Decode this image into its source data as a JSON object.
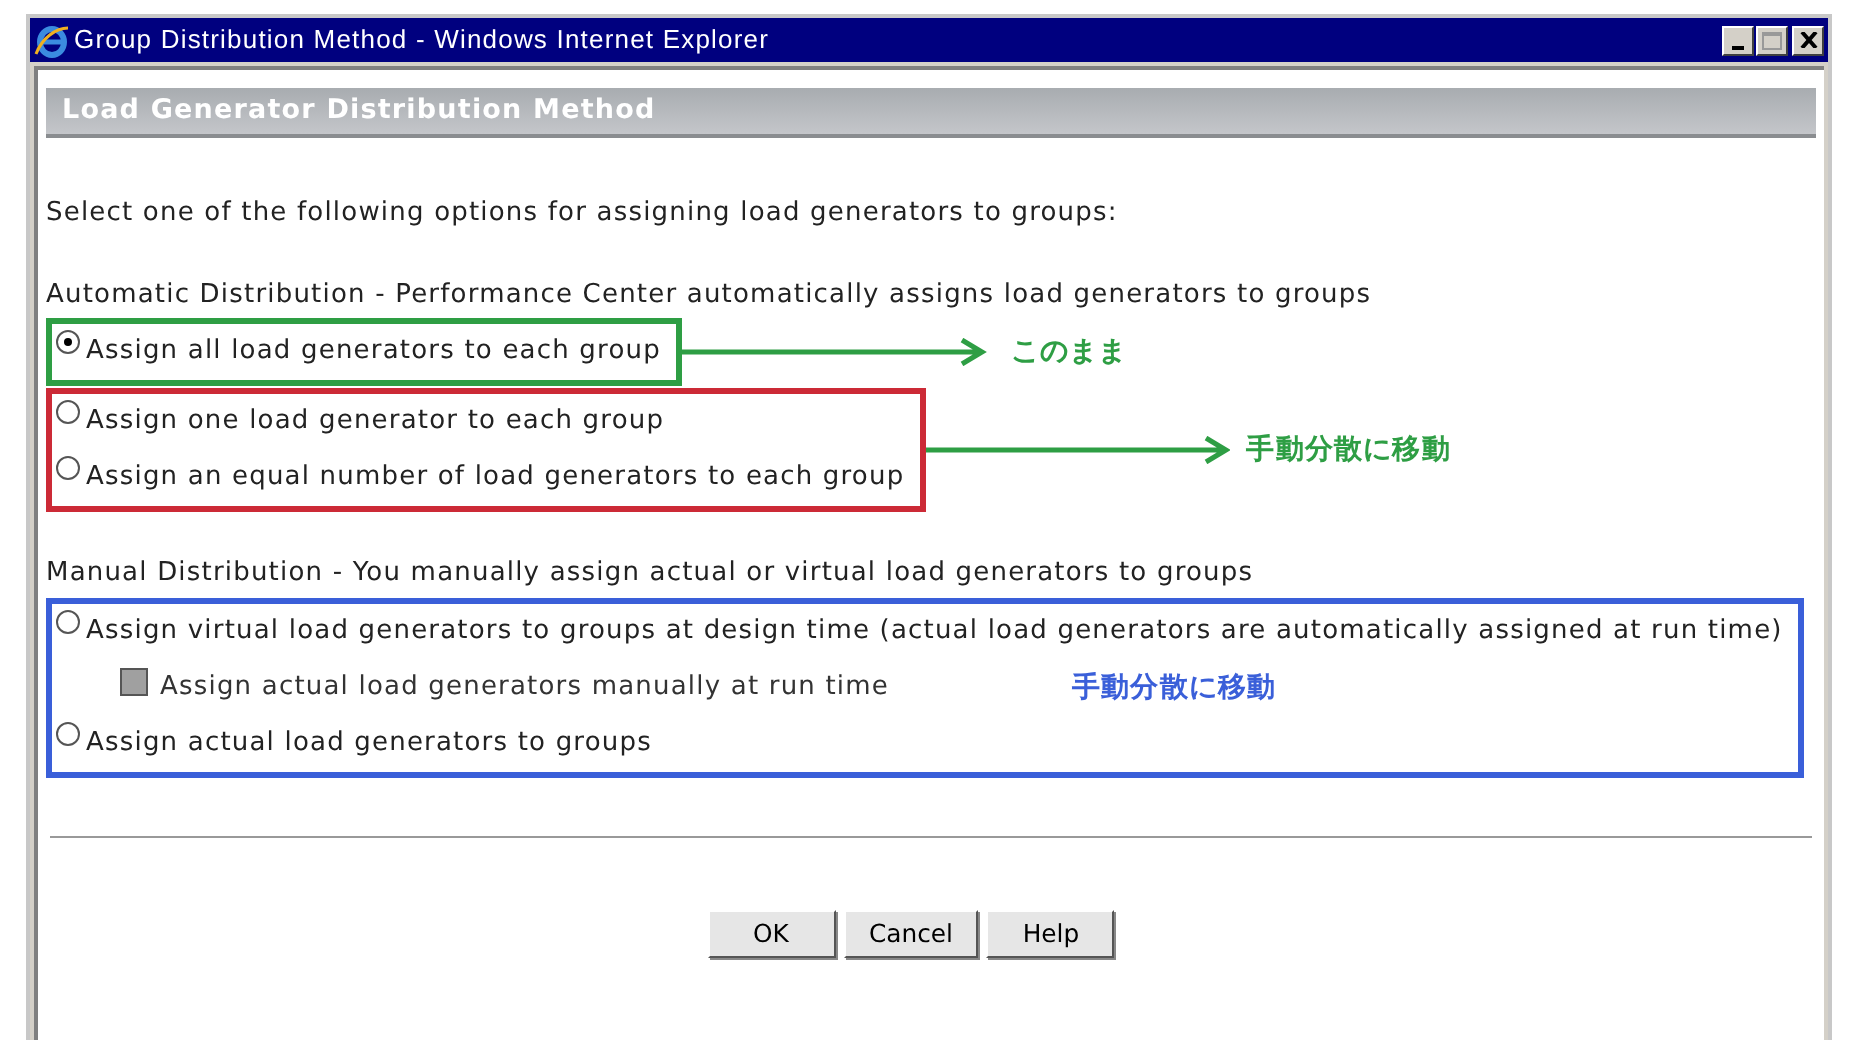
{
  "window": {
    "title": "Group Distribution Method - Windows Internet Explorer"
  },
  "header": "Load Generator Distribution Method",
  "intro": "Select one of the following options for assigning load generators to groups:",
  "sections": [
    {
      "heading": "Automatic Distribution - Performance Center automatically assigns load generators to groups",
      "groups": [
        {
          "annotation": {
            "kind": "arrow",
            "frame": {
              "color": "#2e9e44"
            },
            "label": {
              "text": "このまま",
              "color": "#2e9e44"
            }
          },
          "options": [
            {
              "kind": "radio",
              "label": "Assign all load generators to each group",
              "selected": true
            }
          ]
        },
        {
          "annotation": {
            "kind": "arrow",
            "frame": {
              "color": "#cc2a36"
            },
            "label": {
              "text": "手動分散に移動",
              "color": "#2e9e44"
            }
          },
          "options": [
            {
              "kind": "radio",
              "label": "Assign one load generator to each group",
              "selected": false
            },
            {
              "kind": "radio",
              "label": "Assign an equal number of load generators to each group",
              "selected": false
            }
          ]
        }
      ]
    },
    {
      "heading": "Manual Distribution - You manually assign actual or virtual load generators to groups",
      "groups": [
        {
          "annotation": {
            "kind": "inline",
            "frame": {
              "color": "#3a5fd9"
            },
            "label": {
              "text": "手動分散に移動",
              "color": "#3a5fd9"
            }
          },
          "options": [
            {
              "kind": "radio",
              "label": "Assign virtual load generators to groups at design time (actual load generators are automatically assigned at run time)",
              "selected": false
            },
            {
              "kind": "checkbox",
              "label": "Assign actual load generators manually at run time",
              "checked": false,
              "disabled": true
            },
            {
              "kind": "radio",
              "label": "Assign actual load generators to groups",
              "selected": false
            }
          ]
        }
      ]
    }
  ],
  "buttons": [
    "OK",
    "Cancel",
    "Help"
  ]
}
